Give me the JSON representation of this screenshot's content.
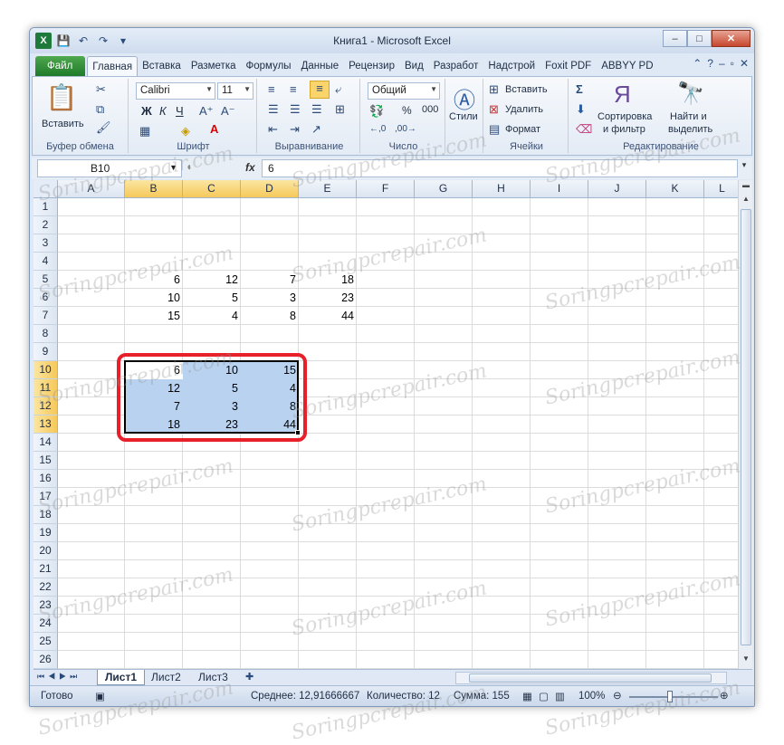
{
  "window": {
    "title": "Книга1 - Microsoft Excel",
    "minimize": "–",
    "maximize": "□",
    "close": "✕"
  },
  "qat": [
    "💾",
    "↶",
    "↷",
    "▾"
  ],
  "tabs": [
    "Файл",
    "Главная",
    "Вставка",
    "Разметка",
    "Формулы",
    "Данные",
    "Рецензир",
    "Вид",
    "Разработ",
    "Надстрой",
    "Foxit PDF",
    "ABBYY PD"
  ],
  "ribbon": {
    "clipboard": {
      "paste": "Вставить",
      "label": "Буфер обмена"
    },
    "font": {
      "name": "Calibri",
      "size": "11",
      "bold": "Ж",
      "italic": "К",
      "underline": "Ч",
      "label": "Шрифт"
    },
    "alignment": {
      "label": "Выравнивание"
    },
    "number": {
      "format": "Общий",
      "percent": "%",
      "thousands": "000",
      "label": "Число"
    },
    "styles": {
      "label": "Стили"
    },
    "cells": {
      "insert": "Вставить",
      "delete": "Удалить",
      "format": "Формат",
      "label": "Ячейки"
    },
    "editing": {
      "sort": "Сортировка",
      "sort2": "и фильтр",
      "find": "Найти и",
      "find2": "выделить",
      "label": "Редактирование"
    }
  },
  "formula_bar": {
    "name_box": "B10",
    "fx": "fx",
    "value": "6"
  },
  "columns": [
    "A",
    "B",
    "C",
    "D",
    "E",
    "F",
    "G",
    "H",
    "I",
    "J",
    "K",
    "L"
  ],
  "rows": [
    "1",
    "2",
    "3",
    "4",
    "5",
    "6",
    "7",
    "8",
    "9",
    "10",
    "11",
    "12",
    "13",
    "14",
    "15",
    "16",
    "17",
    "18",
    "19",
    "20",
    "21",
    "22",
    "23",
    "24",
    "25",
    "26"
  ],
  "cells": [
    {
      "r": 5,
      "c": 1,
      "v": "6"
    },
    {
      "r": 5,
      "c": 2,
      "v": "12"
    },
    {
      "r": 5,
      "c": 3,
      "v": "7"
    },
    {
      "r": 5,
      "c": 4,
      "v": "18"
    },
    {
      "r": 6,
      "c": 1,
      "v": "10"
    },
    {
      "r": 6,
      "c": 2,
      "v": "5"
    },
    {
      "r": 6,
      "c": 3,
      "v": "3"
    },
    {
      "r": 6,
      "c": 4,
      "v": "23"
    },
    {
      "r": 7,
      "c": 1,
      "v": "15"
    },
    {
      "r": 7,
      "c": 2,
      "v": "4"
    },
    {
      "r": 7,
      "c": 3,
      "v": "8"
    },
    {
      "r": 7,
      "c": 4,
      "v": "44"
    },
    {
      "r": 10,
      "c": 1,
      "v": "6"
    },
    {
      "r": 10,
      "c": 2,
      "v": "10"
    },
    {
      "r": 10,
      "c": 3,
      "v": "15"
    },
    {
      "r": 11,
      "c": 1,
      "v": "12"
    },
    {
      "r": 11,
      "c": 2,
      "v": "5"
    },
    {
      "r": 11,
      "c": 3,
      "v": "4"
    },
    {
      "r": 12,
      "c": 1,
      "v": "7"
    },
    {
      "r": 12,
      "c": 2,
      "v": "3"
    },
    {
      "r": 12,
      "c": 3,
      "v": "8"
    },
    {
      "r": 13,
      "c": 1,
      "v": "18"
    },
    {
      "r": 13,
      "c": 2,
      "v": "23"
    },
    {
      "r": 13,
      "c": 3,
      "v": "44"
    }
  ],
  "selection": {
    "range": "B10:D13",
    "highlight_color": "#e8202a"
  },
  "sheets": [
    "Лист1",
    "Лист2",
    "Лист3"
  ],
  "status": {
    "ready": "Готово",
    "average": "Среднее: 12,91666667",
    "count": "Количество: 12",
    "sum": "Сумма: 155",
    "zoom": "100%"
  },
  "watermark": "Soringpcrepair.com"
}
